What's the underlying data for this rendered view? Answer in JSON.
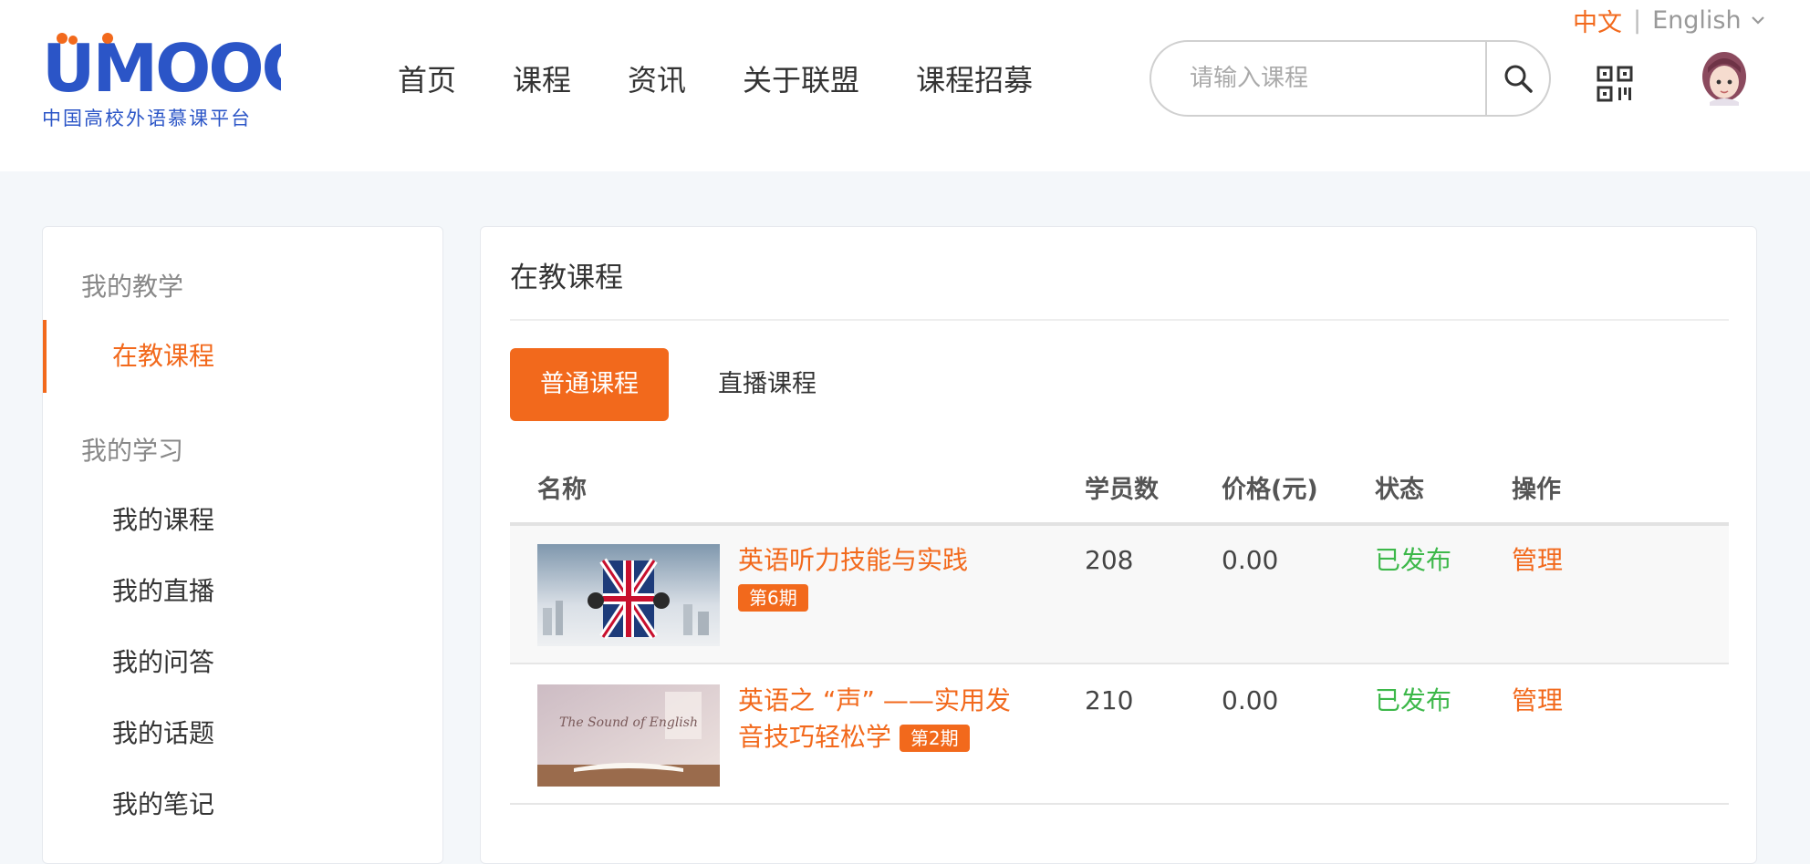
{
  "colors": {
    "accent": "#f2691c",
    "logo_blue": "#2b55c7",
    "published_green": "#3db84a"
  },
  "header": {
    "logo_text": "UMOOCs",
    "logo_subtitle": "中国高校外语慕课平台",
    "nav": [
      "首页",
      "课程",
      "资讯",
      "关于联盟",
      "课程招募"
    ],
    "search": {
      "placeholder": "请输入课程",
      "value": "",
      "icon": "search-icon"
    },
    "lang": {
      "zh": "中文",
      "separator": "|",
      "en": "English"
    },
    "qr_icon": "qr-code-icon",
    "avatar_icon": "user-avatar"
  },
  "sidebar": {
    "groups": [
      {
        "title": "我的教学",
        "items": [
          {
            "label": "在教课程",
            "active": true
          }
        ]
      },
      {
        "title": "我的学习",
        "items": [
          {
            "label": "我的课程"
          },
          {
            "label": "我的直播"
          },
          {
            "label": "我的问答"
          },
          {
            "label": "我的话题"
          },
          {
            "label": "我的笔记"
          }
        ]
      }
    ]
  },
  "main": {
    "title": "在教课程",
    "tabs": [
      {
        "label": "普通课程",
        "active": true
      },
      {
        "label": "直播课程",
        "active": false
      }
    ],
    "columns": [
      "名称",
      "学员数",
      "价格(元)",
      "状态",
      "操作"
    ],
    "rows": [
      {
        "name": "英语听力技能与实践",
        "term": "第6期",
        "students": "208",
        "price": "0.00",
        "status": "已发布",
        "action": "管理",
        "thumb_text": ""
      },
      {
        "name": "英语之 “声” ——实用发音技巧轻松学",
        "term": "第2期",
        "students": "210",
        "price": "0.00",
        "status": "已发布",
        "action": "管理",
        "thumb_text": "The Sound of English"
      }
    ]
  }
}
